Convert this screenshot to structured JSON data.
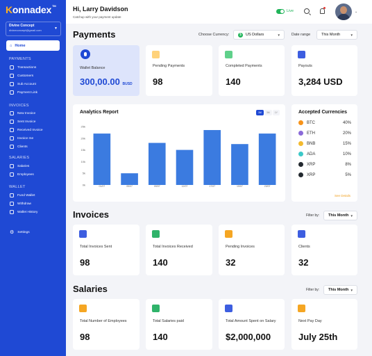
{
  "sidebar": {
    "logo_first": "K",
    "logo_rest": "onnadex",
    "logo_tm": "TM",
    "org_name": "Divine Concept",
    "org_email": "divineconcept@gmail.com",
    "home": "Home",
    "sections": {
      "payments": "PAYMENTS",
      "invoices": "INVOICES",
      "salaries": "SALARIES",
      "wallet": "WALLET"
    },
    "payments_items": [
      "Transactions",
      "Customers",
      "Sub Account",
      "Payment Link"
    ],
    "invoices_items": [
      "New Invoice",
      "Sent Invoice",
      "Received Invoice",
      "Invoice me",
      "Clients"
    ],
    "salaries_items": [
      "Salaries",
      "Employees"
    ],
    "wallet_items": [
      "Fund Wallet",
      "Withdraw",
      "Wallet History"
    ],
    "settings": "Settings"
  },
  "topbar": {
    "greeting": "Hi, Larry Davidson",
    "subtitle": "Catchup with your payment update",
    "live_label": "Live"
  },
  "payments": {
    "title": "Payments",
    "currency_label": "Choose Currency:",
    "currency_value": "US Dollars",
    "daterange_label": "Date range",
    "daterange_value": "This Month",
    "wallet_label": "Wallet Balance",
    "wallet_value": "300,00.00",
    "wallet_unit": "BUSD",
    "pending_label": "Pending Payments",
    "pending_value": "98",
    "completed_label": "Completed Payments",
    "completed_value": "140",
    "payouts_label": "Payouts",
    "payouts_value": "3,284 USD"
  },
  "analytics": {
    "title": "Analytics Report",
    "pills": [
      "1M",
      "3M",
      "1Y"
    ]
  },
  "chart_data": {
    "type": "bar",
    "title": "Analytics Report",
    "categories": [
      "01/07",
      "05/07",
      "09/07",
      "12/07",
      "17/07",
      "19/07",
      "23/07"
    ],
    "values": [
      22,
      5,
      18,
      15,
      23.5,
      17.5,
      22
    ],
    "yticks": [
      "25k",
      "20k",
      "15k",
      "10k",
      "5k",
      "0k"
    ],
    "ylim": [
      0,
      25
    ],
    "color": "#3b7be0"
  },
  "currencies": {
    "title": "Accepted Currencies",
    "items": [
      {
        "name": "BTC",
        "pct": "40%",
        "color": "#f7931a"
      },
      {
        "name": "ETH",
        "pct": "20%",
        "color": "#8a6ad8"
      },
      {
        "name": "BNB",
        "pct": "15%",
        "color": "#f3ba2f"
      },
      {
        "name": "ADA",
        "pct": "10%",
        "color": "#3cc8c8"
      },
      {
        "name": "XRP",
        "pct": "8%",
        "color": "#23292f"
      },
      {
        "name": "XRP",
        "pct": "5%",
        "color": "#23292f"
      }
    ],
    "see_details": "See Details"
  },
  "invoices": {
    "title": "Invoices",
    "filter_label": "Filter by:",
    "filter_value": "This Month",
    "cards": [
      {
        "label": "Total Invoices Sent",
        "value": "98"
      },
      {
        "label": "Total Invoices Received",
        "value": "140"
      },
      {
        "label": "Pending Invoices",
        "value": "32"
      },
      {
        "label": "Clients",
        "value": "32"
      }
    ]
  },
  "salaries": {
    "title": "Salaries",
    "filter_label": "Filter by:",
    "filter_value": "This Month",
    "cards": [
      {
        "label": "Total Number of Employees",
        "value": "98"
      },
      {
        "label": "Total Salaries paid",
        "value": "140"
      },
      {
        "label": "Total Amount Spent on Salary",
        "value": "$2,000,000"
      },
      {
        "label": "Next Pay Day",
        "value": "July 25th"
      }
    ]
  }
}
